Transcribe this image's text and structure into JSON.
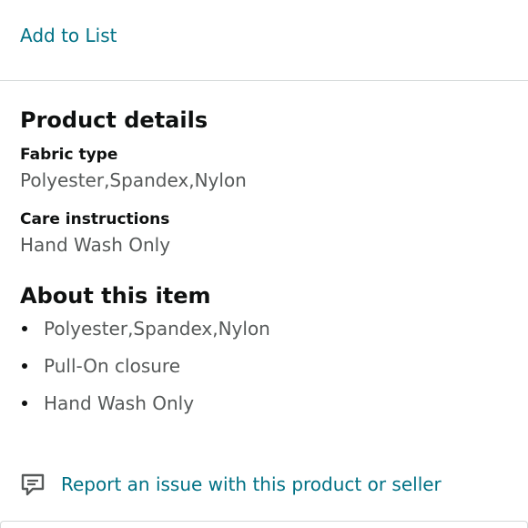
{
  "actions": {
    "add_to_list": "Add to List"
  },
  "product_details": {
    "title": "Product details",
    "rows": [
      {
        "label": "Fabric type",
        "value": "Polyester,Spandex,Nylon"
      },
      {
        "label": "Care instructions",
        "value": "Hand Wash Only"
      }
    ]
  },
  "about": {
    "title": "About this item",
    "bullets": [
      "Polyester,Spandex,Nylon",
      "Pull-On closure",
      "Hand Wash Only"
    ]
  },
  "report": {
    "icon": "report-icon",
    "label": "Report an issue with this product or seller"
  },
  "colors": {
    "link": "#007185",
    "text_primary": "#0f1111",
    "text_secondary": "#565959",
    "divider": "#d5d9d9"
  }
}
